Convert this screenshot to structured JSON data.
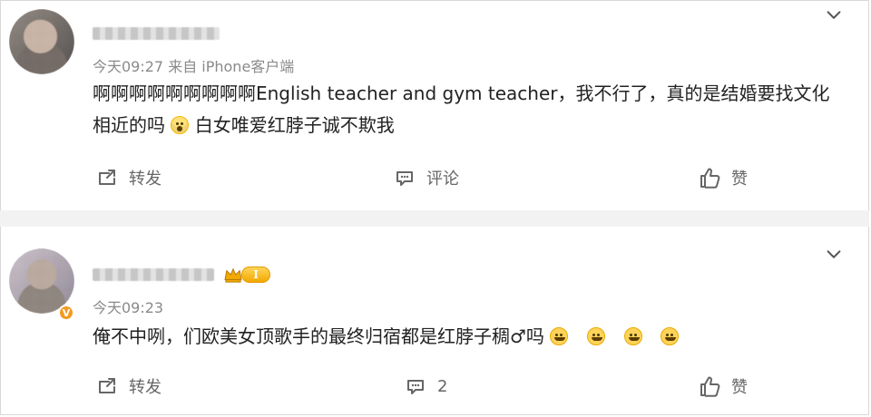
{
  "posts": [
    {
      "time_source": "今天09:27 来自 iPhone客户端",
      "content_part1": "啊啊啊啊啊啊啊啊啊English teacher and gym teacher，我不行了，真的是结婚要找文化",
      "content_part2": "相近的吗",
      "content_part3": "白女唯爱红脖子诚不欺我",
      "actions": {
        "repost": "转发",
        "comment": "评论",
        "like": "赞"
      }
    },
    {
      "time_source": "今天09:23",
      "content": "俺不中咧，们欧美女顶歌手的最终归宿都是红脖子稠♂吗",
      "badge_level": "I",
      "actions": {
        "repost": "转发",
        "comment_count": "2",
        "like": "赞"
      }
    }
  ],
  "icons": {
    "chevron": "chevron-down-icon",
    "repost": "repost-icon",
    "comment": "comment-icon",
    "like": "like-icon",
    "crown": "crown-icon",
    "verified": "verified-icon"
  },
  "colors": {
    "text": "#222222",
    "meta": "#8a8a8a",
    "action": "#666666",
    "divider": "#f2f2f2",
    "verified": "#f39a1f",
    "gold": "#f2a900"
  }
}
